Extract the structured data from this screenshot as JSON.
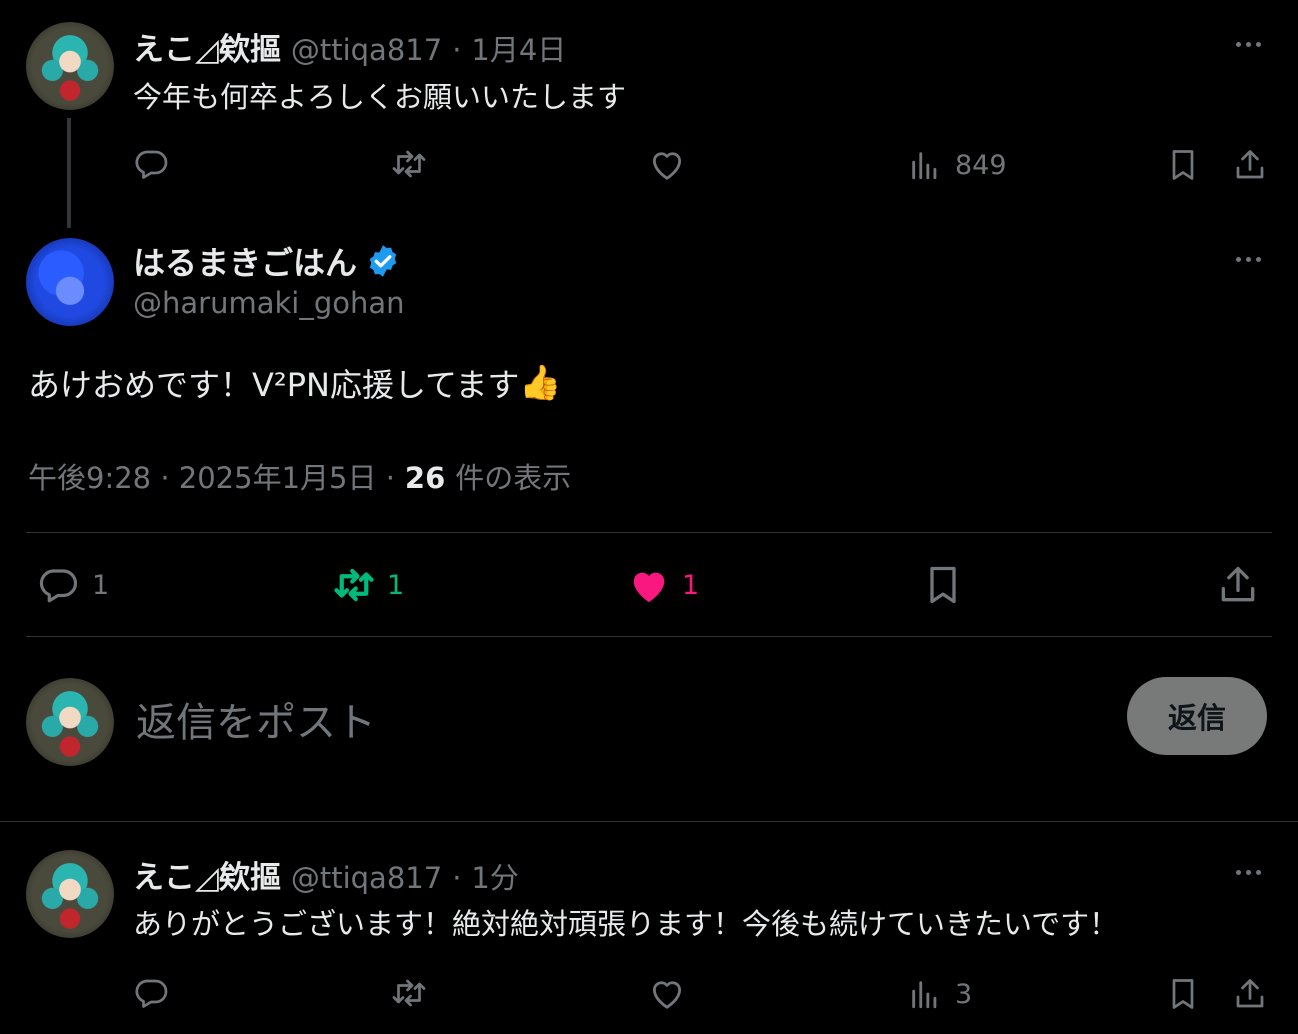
{
  "tweet1": {
    "author": "えこ◿欸摳",
    "handle": "@ttiqa817",
    "sep": "·",
    "time": "1月4日",
    "text": "今年も何卒よろしくお願いいたします",
    "views": "849"
  },
  "main": {
    "author": "はるまきごはん",
    "handle": "@harumaki_gohan",
    "text": "あけおめです！V²PN応援してます",
    "emoji": "👍",
    "time": "午後9:28 · 2025年1月5日 ·",
    "views_count": "26",
    "views_label": "件の表示",
    "replies": "1",
    "reposts": "1",
    "likes": "1"
  },
  "composer": {
    "placeholder": "返信をポスト",
    "button": "返信"
  },
  "tweet2": {
    "author": "えこ◿欸摳",
    "handle": "@ttiqa817",
    "sep": "·",
    "time": "1分",
    "text": "ありがとうございます！絶対絶対頑張ります！今後も続けていきたいです！",
    "views": "3"
  },
  "colors": {
    "background": "#000000",
    "text": "#e7e9ea",
    "muted": "#71767b",
    "repost_active": "#00ba7c",
    "like_active": "#f91880",
    "verified": "#1d9bf0"
  }
}
